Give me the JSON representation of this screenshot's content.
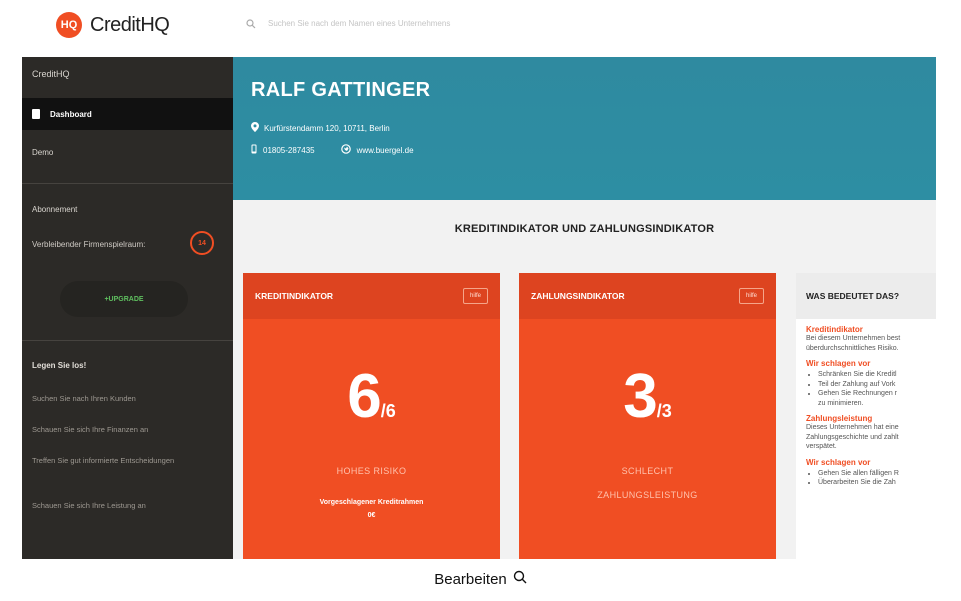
{
  "brand": {
    "logo_mark": "HQ",
    "name": "CreditHQ"
  },
  "search": {
    "placeholder": "Suchen Sie nach dem Namen eines Unternehmens"
  },
  "sidebar": {
    "brand": "CreditHQ",
    "active_item": "Dashboard",
    "demo": "Demo",
    "abo_heading": "Abonnement",
    "remaining_label": "Verbleibender Firmenspielraum:",
    "remaining_count": "14",
    "upgrade_label": "+UPGRADE",
    "legen_heading": "Legen Sie los!",
    "links": [
      "Suchen Sie nach Ihren Kunden",
      "Schauen Sie sich Ihre Finanzen an",
      "Treffen Sie gut informierte Entscheidungen",
      "Schauen Sie sich Ihre Leistung an"
    ]
  },
  "company": {
    "name": "RALF GATTINGER",
    "address": "Kurfürstendamm 120, 10711, Berlin",
    "phone": "01805-287435",
    "website": "www.buergel.de"
  },
  "main": {
    "section_title": "KREDITINDIKATOR UND ZAHLUNGSINDIKATOR",
    "cards": [
      {
        "title": "KREDITINDIKATOR",
        "help": "hilfe",
        "score": "6",
        "max": "/6",
        "risk_line1": "HOHES RISIKO",
        "risk_line2": "",
        "comp_line1": "Vorgeschlagener Kreditrahmen",
        "comp_line2": "0€"
      },
      {
        "title": "ZAHLUNGSINDIKATOR",
        "help": "hilfe",
        "score": "3",
        "max": "/3",
        "risk_line1": "SCHLECHT",
        "risk_line2": "ZAHLUNGSLEISTUNG",
        "comp_line1": "",
        "comp_line2": ""
      }
    ],
    "info": {
      "title": "WAS BEDEUTET DAS?",
      "kredit_heading": "Kreditindikator",
      "kredit_text": [
        "Bei diesem Unternehmen best",
        "überdurchschnittliches Risiko."
      ],
      "suggest_heading_1": "Wir schlagen vor",
      "suggest_list_1": [
        "Schränken Sie die Kreditl",
        "Teil der Zahlung auf Vork",
        "Gehen Sie Rechnungen r",
        "zu minimieren."
      ],
      "zahlung_heading": "Zahlungsleistung",
      "zahlung_text": [
        "Dieses Unternehmen hat eine",
        "Zahlungsgeschichte und zahlt",
        "verspätet."
      ],
      "suggest_heading_2": "Wir schlagen vor",
      "suggest_list_2": [
        "Gehen Sie allen fälligen R",
        "Überarbeiten Sie die Zah"
      ]
    }
  },
  "caption": {
    "label": "Bearbeiten"
  },
  "colors": {
    "accent": "#f04e23",
    "hero": "#2d8ea3",
    "sidebar": "#2c2a27"
  }
}
